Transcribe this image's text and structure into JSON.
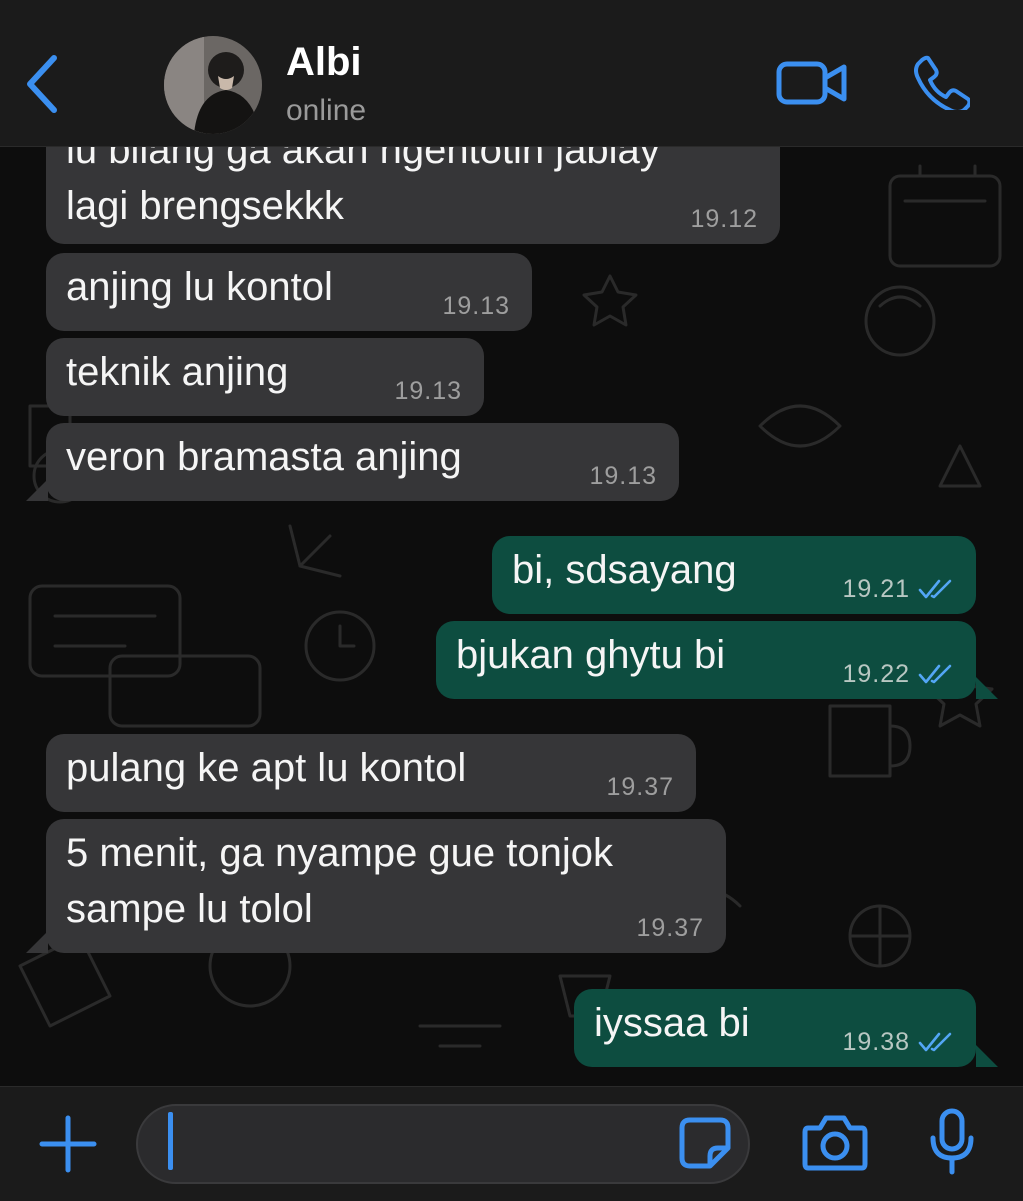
{
  "header": {
    "contact_name": "Albi",
    "status": "online",
    "accent_color": "#3b8ff0"
  },
  "icons": {
    "back": "chevron-left-icon",
    "video": "video-camera-icon",
    "call": "phone-icon",
    "plus": "plus-icon",
    "sticker": "sticker-icon",
    "camera": "camera-icon",
    "mic": "microphone-icon",
    "read_receipt": "double-check-icon"
  },
  "messages": [
    {
      "direction": "in",
      "lines": [
        "lu bilang ga akan ngentotin jablay",
        "lagi brengsekkk"
      ],
      "time": "19.12"
    },
    {
      "direction": "in",
      "lines": [
        "anjing lu kontol"
      ],
      "time": "19.13"
    },
    {
      "direction": "in",
      "lines": [
        "teknik anjing"
      ],
      "time": "19.13"
    },
    {
      "direction": "in",
      "lines": [
        "veron bramasta anjing"
      ],
      "time": "19.13"
    },
    {
      "direction": "out",
      "lines": [
        "bi, sdsayang"
      ],
      "time": "19.21",
      "read": true
    },
    {
      "direction": "out",
      "lines": [
        "bjukan ghytu bi"
      ],
      "time": "19.22",
      "read": true
    },
    {
      "direction": "in",
      "lines": [
        "pulang ke apt lu kontol"
      ],
      "time": "19.37"
    },
    {
      "direction": "in",
      "lines": [
        "5 menit, ga nyampe gue tonjok",
        "sampe lu tolol"
      ],
      "time": "19.37"
    },
    {
      "direction": "out",
      "lines": [
        "iyssaa bi"
      ],
      "time": "19.38",
      "read": true
    }
  ],
  "input": {
    "value": "",
    "placeholder": ""
  },
  "colors": {
    "incoming_bubble": "#363638",
    "outgoing_bubble": "#0d4d40",
    "read_tick": "#53a6f5"
  }
}
